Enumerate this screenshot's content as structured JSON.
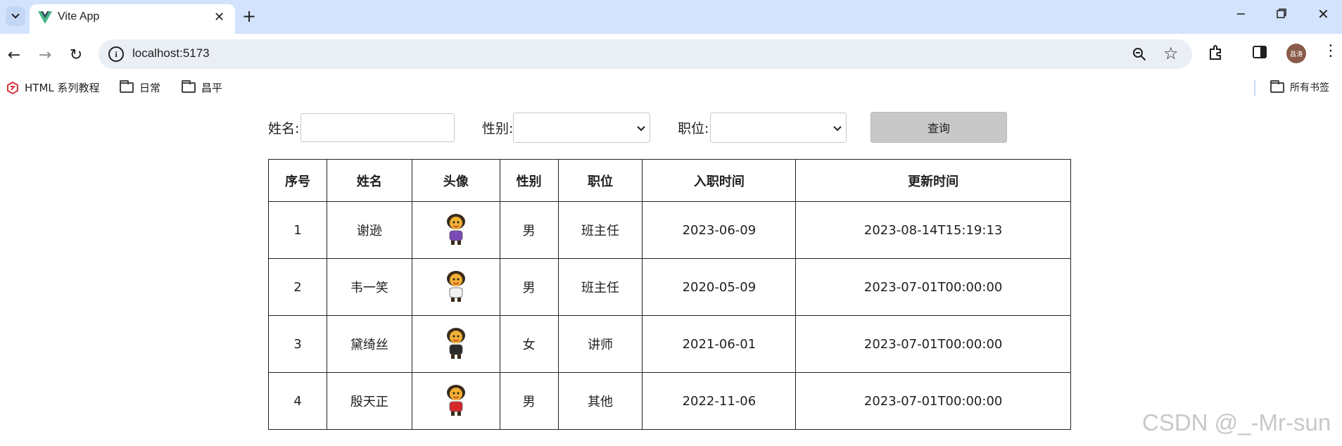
{
  "browser": {
    "tab_title": "Vite App",
    "tab_close": "✕",
    "new_tab": "+",
    "url": "localhost:5173",
    "avatar_text": "昌涛",
    "win_min": "─",
    "win_close": "✕",
    "menu": "⋮",
    "back": "←",
    "forward": "→",
    "reload": "↻",
    "site_info": "i",
    "star": "☆"
  },
  "bookmarks": {
    "items": [
      "HTML 系列教程",
      "日常",
      "昌平"
    ],
    "all_bookmarks": "所有书签"
  },
  "form": {
    "name_label": "姓名:",
    "name_value": "",
    "gender_label": "性别:",
    "gender_value": "",
    "position_label": "职位:",
    "position_value": "",
    "query_label": "查询"
  },
  "table": {
    "headers": [
      "序号",
      "姓名",
      "头像",
      "性别",
      "职位",
      "入职时间",
      "更新时间"
    ],
    "rows": [
      {
        "id": "1",
        "name": "谢逊",
        "gender": "男",
        "position": "班主任",
        "entry": "2023-06-09",
        "updated": "2023-08-14T15:19:13",
        "avatar_color": "#7b4bb5"
      },
      {
        "id": "2",
        "name": "韦一笑",
        "gender": "男",
        "position": "班主任",
        "entry": "2020-05-09",
        "updated": "2023-07-01T00:00:00",
        "avatar_color": "#f2f2f2"
      },
      {
        "id": "3",
        "name": "黛绮丝",
        "gender": "女",
        "position": "讲师",
        "entry": "2021-06-01",
        "updated": "2023-07-01T00:00:00",
        "avatar_color": "#2b2b2b"
      },
      {
        "id": "4",
        "name": "殷天正",
        "gender": "男",
        "position": "其他",
        "entry": "2022-11-06",
        "updated": "2023-07-01T00:00:00",
        "avatar_color": "#d62828"
      }
    ]
  },
  "watermark": "CSDN @_-Mr-sun",
  "colors": {
    "tabstrip": "#d3e3fd",
    "omnibox": "#eaeef5",
    "query_button": "#c8c8c8"
  }
}
